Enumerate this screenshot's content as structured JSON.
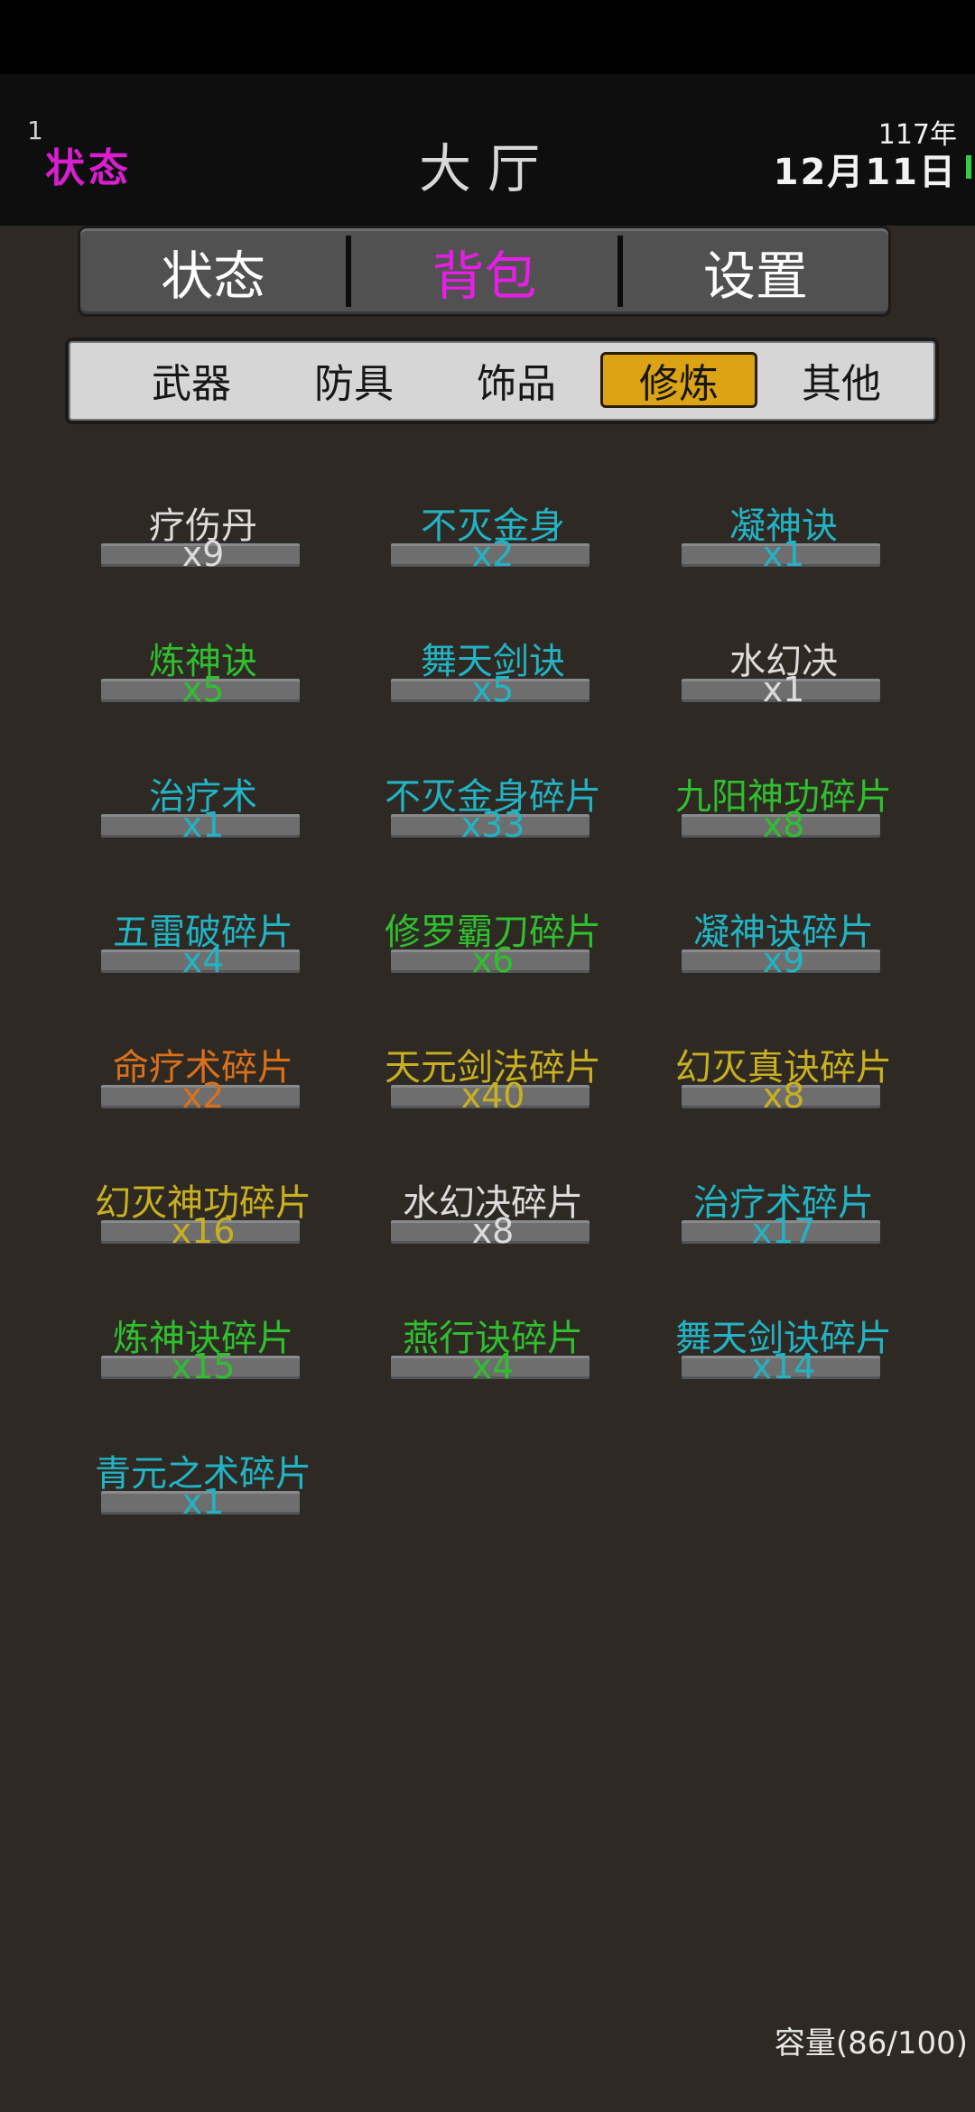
{
  "status_bar": {
    "left_number": "1",
    "state_label": "状态",
    "title": "大厅",
    "year": "117年",
    "date": "12月11日"
  },
  "main_tabs": [
    {
      "label": "状态",
      "active": false
    },
    {
      "label": "背包",
      "active": true
    },
    {
      "label": "设置",
      "active": false
    }
  ],
  "sub_tabs": [
    {
      "label": "武器",
      "active": false
    },
    {
      "label": "防具",
      "active": false
    },
    {
      "label": "饰品",
      "active": false
    },
    {
      "label": "修炼",
      "active": true
    },
    {
      "label": "其他",
      "active": false
    }
  ],
  "colors": {
    "white": "#dcdcdc",
    "cyan": "#22b3c4",
    "green": "#2fbf2f",
    "orange": "#d9701c",
    "yellow": "#c8b020",
    "accent_magenta": "#e61ee6",
    "active_tab_gold": "#dca314"
  },
  "items": [
    {
      "name": "疗伤丹",
      "count": "x9",
      "color": "#dcdcdc"
    },
    {
      "name": "不灭金身",
      "count": "x2",
      "color": "#22b3c4"
    },
    {
      "name": "凝神诀",
      "count": "x1",
      "color": "#22b3c4"
    },
    {
      "name": "炼神诀",
      "count": "x5",
      "color": "#2fbf2f"
    },
    {
      "name": "舞天剑诀",
      "count": "x5",
      "color": "#22b3c4"
    },
    {
      "name": "水幻决",
      "count": "x1",
      "color": "#dcdcdc"
    },
    {
      "name": "治疗术",
      "count": "x1",
      "color": "#22b3c4"
    },
    {
      "name": "不灭金身碎片",
      "count": "x33",
      "color": "#22b3c4"
    },
    {
      "name": "九阳神功碎片",
      "count": "x8",
      "color": "#2fbf2f"
    },
    {
      "name": "五雷破碎片",
      "count": "x4",
      "color": "#22b3c4"
    },
    {
      "name": "修罗霸刀碎片",
      "count": "x6",
      "color": "#2fbf2f"
    },
    {
      "name": "凝神诀碎片",
      "count": "x9",
      "color": "#22b3c4"
    },
    {
      "name": "命疗术碎片",
      "count": "x2",
      "color": "#d9701c"
    },
    {
      "name": "天元剑法碎片",
      "count": "x40",
      "color": "#c8b020"
    },
    {
      "name": "幻灭真诀碎片",
      "count": "x8",
      "color": "#c8b020"
    },
    {
      "name": "幻灭神功碎片",
      "count": "x16",
      "color": "#c8b020"
    },
    {
      "name": "水幻决碎片",
      "count": "x8",
      "color": "#dcdcdc"
    },
    {
      "name": "治疗术碎片",
      "count": "x17",
      "color": "#22b3c4"
    },
    {
      "name": "炼神诀碎片",
      "count": "x15",
      "color": "#2fbf2f"
    },
    {
      "name": "燕行诀碎片",
      "count": "x4",
      "color": "#2fbf2f"
    },
    {
      "name": "舞天剑诀碎片",
      "count": "x14",
      "color": "#22b3c4"
    },
    {
      "name": "青元之术碎片",
      "count": "x1",
      "color": "#22b3c4"
    }
  ],
  "capacity": "容量(86/100)"
}
